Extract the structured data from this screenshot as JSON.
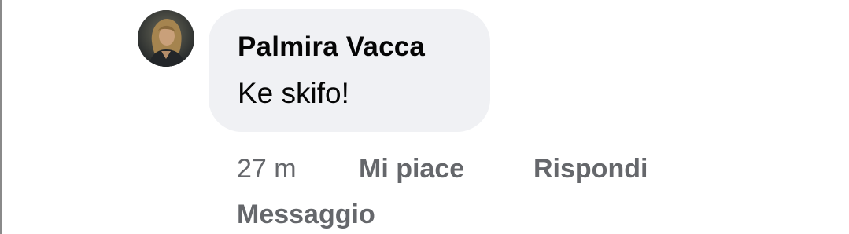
{
  "comment": {
    "author": "Palmira Vacca",
    "text": "Ke skifo!",
    "time": "27 m",
    "actions": {
      "like": "Mi piace",
      "reply": "Rispondi",
      "message": "Messaggio"
    }
  },
  "colors": {
    "bubble": "#f0f1f4",
    "text": "#050505",
    "secondary": "#65676b"
  }
}
